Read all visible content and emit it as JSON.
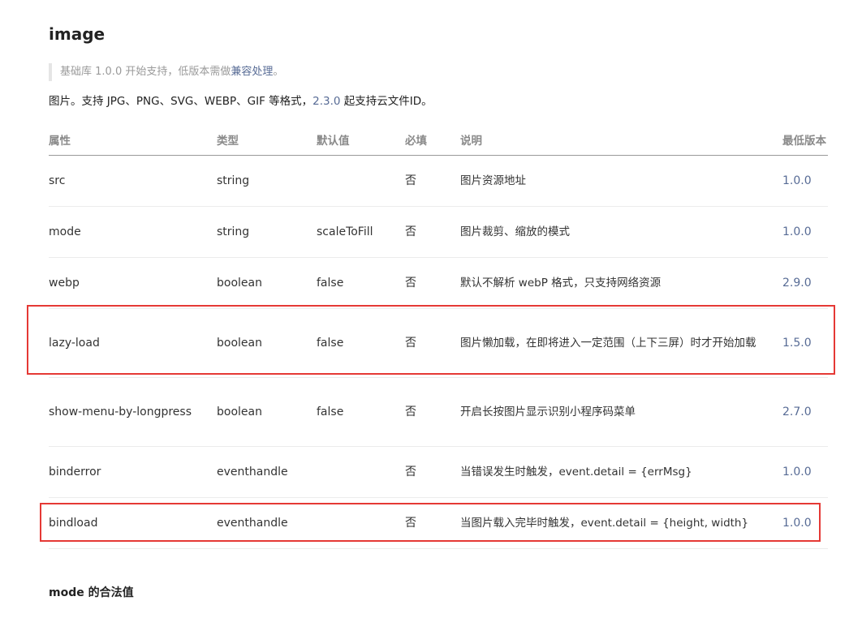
{
  "title": "image",
  "note": {
    "prefix": "基础库 1.0.0 开始支持，低版本需做",
    "link": "兼容处理",
    "suffix": "。"
  },
  "description": {
    "prefix": "图片。支持 JPG、PNG、SVG、WEBP、GIF 等格式，",
    "version_link": "2.3.0",
    "suffix": " 起支持云文件ID。"
  },
  "table": {
    "headers": [
      "属性",
      "类型",
      "默认值",
      "必填",
      "说明",
      "最低版本"
    ],
    "rows": [
      {
        "name": "src",
        "type": "string",
        "default": "",
        "required": "否",
        "desc": "图片资源地址",
        "version": "1.0.0"
      },
      {
        "name": "mode",
        "type": "string",
        "default": "scaleToFill",
        "required": "否",
        "desc": "图片裁剪、缩放的模式",
        "version": "1.0.0"
      },
      {
        "name": "webp",
        "type": "boolean",
        "default": "false",
        "required": "否",
        "desc": "默认不解析 webP 格式，只支持网络资源",
        "version": "2.9.0"
      },
      {
        "name": "lazy-load",
        "type": "boolean",
        "default": "false",
        "required": "否",
        "desc": "图片懒加载，在即将进入一定范围（上下三屏）时才开始加载",
        "version": "1.5.0"
      },
      {
        "name": "show-menu-by-longpress",
        "type": "boolean",
        "default": "false",
        "required": "否",
        "desc": "开启长按图片显示识别小程序码菜单",
        "version": "2.7.0"
      },
      {
        "name": "binderror",
        "type": "eventhandle",
        "default": "",
        "required": "否",
        "desc": "当错误发生时触发，event.detail = {errMsg}",
        "version": "1.0.0"
      },
      {
        "name": "bindload",
        "type": "eventhandle",
        "default": "",
        "required": "否",
        "desc": "当图片载入完毕时触发，event.detail = {height, width}",
        "version": "1.0.0"
      }
    ]
  },
  "section_title": "mode 的合法值",
  "colors": {
    "link": "#576b95",
    "highlight": "#e53935"
  }
}
